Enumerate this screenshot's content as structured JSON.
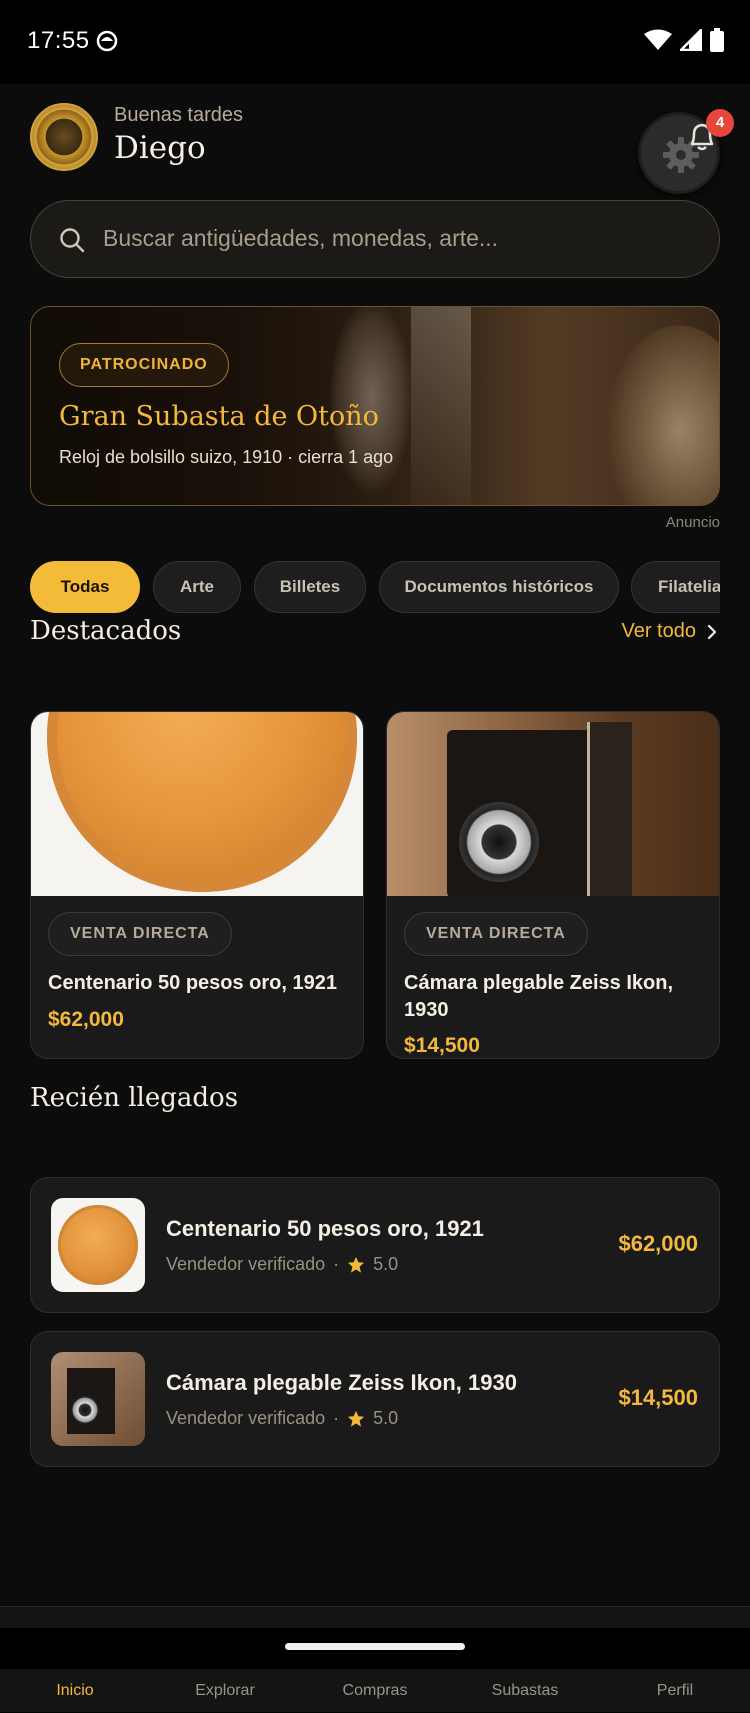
{
  "status": {
    "time": "17:55"
  },
  "header": {
    "greeting": "Buenas tardes",
    "user_name": "Diego",
    "notification_count": "4"
  },
  "search": {
    "placeholder": "Buscar antigüedades, monedas, arte...",
    "value": ""
  },
  "promo": {
    "badge": "PATROCINADO",
    "title": "Gran Subasta de Otoño",
    "subtitle": "Reloj de bolsillo suizo, 1910 · cierra 1 ago",
    "ad_label": "Anuncio"
  },
  "categories": [
    "Todas",
    "Arte",
    "Billetes",
    "Documentos históricos",
    "Filatelia"
  ],
  "active_category": "Todas",
  "featured": {
    "title": "Destacados",
    "see_all": "Ver todo",
    "items": [
      {
        "tag": "VENTA DIRECTA",
        "name": "Centenario 50 pesos oro, 1921",
        "price": "$62,000",
        "image": "gold-coin"
      },
      {
        "tag": "VENTA DIRECTA",
        "name": "Cámara plegable Zeiss Ikon, 1930",
        "price": "$14,500",
        "image": "vintage-camera"
      }
    ]
  },
  "recent": {
    "title": "Recién llegados",
    "items": [
      {
        "name": "Centenario 50 pesos oro, 1921",
        "seller": "Vendedor verificado",
        "rating": "5.0",
        "price": "$62,000",
        "image": "gold-coin"
      },
      {
        "name": "Cámara plegable Zeiss Ikon, 1930",
        "seller": "Vendedor verificado",
        "rating": "5.0",
        "price": "$14,500",
        "image": "vintage-camera"
      }
    ]
  },
  "nav": {
    "items": [
      {
        "label": "Inicio",
        "icon": "home-icon",
        "active": true
      },
      {
        "label": "Explorar",
        "icon": "search-icon",
        "active": false
      },
      {
        "label": "Compras",
        "icon": "cart-icon",
        "active": false
      },
      {
        "label": "Subastas",
        "icon": "gavel-icon",
        "active": false
      },
      {
        "label": "Perfil",
        "icon": "user-icon",
        "active": false
      }
    ]
  },
  "colors": {
    "accent": "#f4b83c",
    "background": "#0c0c0c",
    "card": "#1a1a1a",
    "badge": "#e5483a"
  }
}
